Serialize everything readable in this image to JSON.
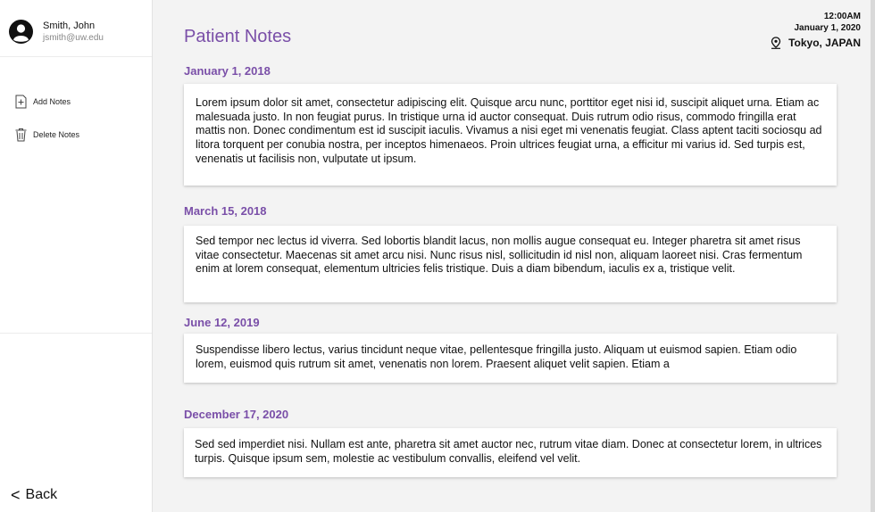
{
  "user": {
    "name": "Smith, John",
    "email": "jsmith@uw.edu"
  },
  "menu": {
    "add_label": "Add Notes",
    "delete_label": "Delete Notes"
  },
  "back_label": "Back",
  "page": {
    "title": "Patient Notes"
  },
  "header": {
    "time": "12:00AM",
    "date": "January 1, 2020",
    "location": "Tokyo, JAPAN"
  },
  "notes": [
    {
      "date": "January 1, 2018",
      "text": "Lorem ipsum dolor sit amet, consectetur adipiscing elit. Quisque arcu nunc, porttitor eget nisi id, suscipit aliquet urna. Etiam ac malesuada justo. In non feugiat purus. In tristique urna id auctor consequat. Duis rutrum odio risus, commodo fringilla erat mattis non. Donec condimentum est id suscipit iaculis. Vivamus a nisi eget mi venenatis feugiat. Class aptent taciti sociosqu ad litora torquent per conubia nostra, per inceptos himenaeos. Proin ultrices feugiat urna, a efficitur mi varius id. Sed turpis est, venenatis ut facilisis non, vulputate ut ipsum."
    },
    {
      "date": "March 15, 2018",
      "text": "Sed tempor nec lectus id viverra. Sed lobortis blandit lacus, non mollis augue consequat eu. Integer pharetra sit amet risus vitae consectetur. Maecenas sit amet arcu nisi. Nunc risus nisl, sollicitudin id nisl non, aliquam laoreet nisi. Cras fermentum enim at lorem consequat, elementum ultricies felis tristique. Duis a diam bibendum, iaculis ex a, tristique velit."
    },
    {
      "date": "June 12, 2019",
      "text": "Suspendisse libero lectus, varius tincidunt neque vitae, pellentesque fringilla justo. Aliquam ut euismod sapien. Etiam odio lorem, euismod quis rutrum sit amet, venenatis non lorem. Praesent aliquet velit sapien. Etiam a"
    },
    {
      "date": "December 17, 2020",
      "text": "Sed sed imperdiet nisi. Nullam est ante, pharetra sit amet auctor nec, rutrum vitae diam. Donec at consectetur lorem, in ultrices turpis. Quisque ipsum sem, molestie ac vestibulum convallis, eleifend vel velit."
    }
  ],
  "colors": {
    "accent": "#7a4fa8",
    "card": "#ffffff",
    "background": "#f3f3f3"
  },
  "icons": {
    "avatar": "user-avatar-icon",
    "add": "add-note-icon",
    "delete": "trash-icon",
    "location": "location-pin-icon",
    "back": "chevron-left-icon"
  }
}
